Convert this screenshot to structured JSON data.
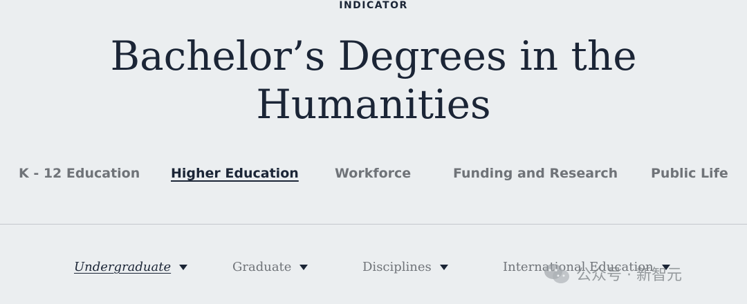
{
  "header": {
    "kicker": "INDICATOR",
    "title_line1": "Bachelor’s Degrees in the",
    "title_line2": "Humanities"
  },
  "main_nav": {
    "items": [
      {
        "label": "K - 12 Education",
        "active": false
      },
      {
        "label": "Higher Education",
        "active": true
      },
      {
        "label": "Workforce",
        "active": false
      },
      {
        "label": "Funding and Research",
        "active": false
      },
      {
        "label": "Public Life",
        "active": false
      }
    ]
  },
  "sub_nav": {
    "items": [
      {
        "label": "Undergraduate",
        "active": true,
        "icon": "caret-down-icon"
      },
      {
        "label": "Graduate",
        "active": false,
        "icon": "caret-down-icon"
      },
      {
        "label": "Disciplines",
        "active": false,
        "icon": "caret-down-icon"
      },
      {
        "label": "International Education",
        "active": false,
        "icon": "caret-down-icon"
      }
    ]
  },
  "watermark": {
    "text": "公众号 · 新智元",
    "icon": "wechat-logo-icon"
  },
  "colors": {
    "background": "#ebeef0",
    "text_dark": "#1b2536",
    "text_muted": "#6f7378",
    "divider": "#c4c8cc"
  }
}
